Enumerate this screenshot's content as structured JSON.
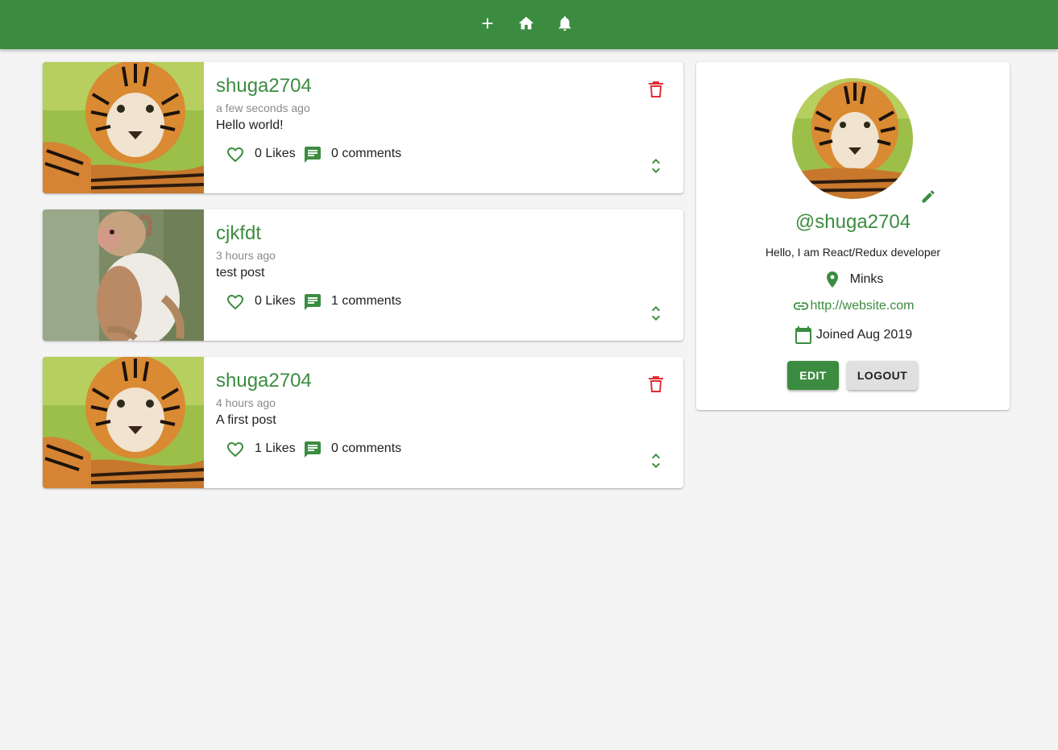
{
  "appbar": {
    "color": "#3b8c40",
    "icons": [
      "add-icon",
      "home-icon",
      "notifications-icon"
    ]
  },
  "posts": [
    {
      "username": "shuga2704",
      "time": "a few seconds ago",
      "body": "Hello world!",
      "likes_label": "0 Likes",
      "comments_label": "0 comments",
      "image": "tiger",
      "deletable": true
    },
    {
      "username": "cjkfdt",
      "time": "3 hours ago",
      "body": "test post",
      "likes_label": "0 Likes",
      "comments_label": "1 comments",
      "image": "monkey",
      "deletable": false
    },
    {
      "username": "shuga2704",
      "time": "4 hours ago",
      "body": "A first post",
      "likes_label": "1 Likes",
      "comments_label": "0 comments",
      "image": "tiger",
      "deletable": true
    }
  ],
  "profile": {
    "handle": "@shuga2704",
    "bio": "Hello, I am React/Redux developer",
    "location": "Minks",
    "website": "http://website.com",
    "joined": "Joined Aug 2019",
    "edit_label": "EDIT",
    "logout_label": "LOGOUT"
  },
  "colors": {
    "primary": "#3b8c40",
    "danger": "#e02b36",
    "background": "#f4f4f4"
  }
}
